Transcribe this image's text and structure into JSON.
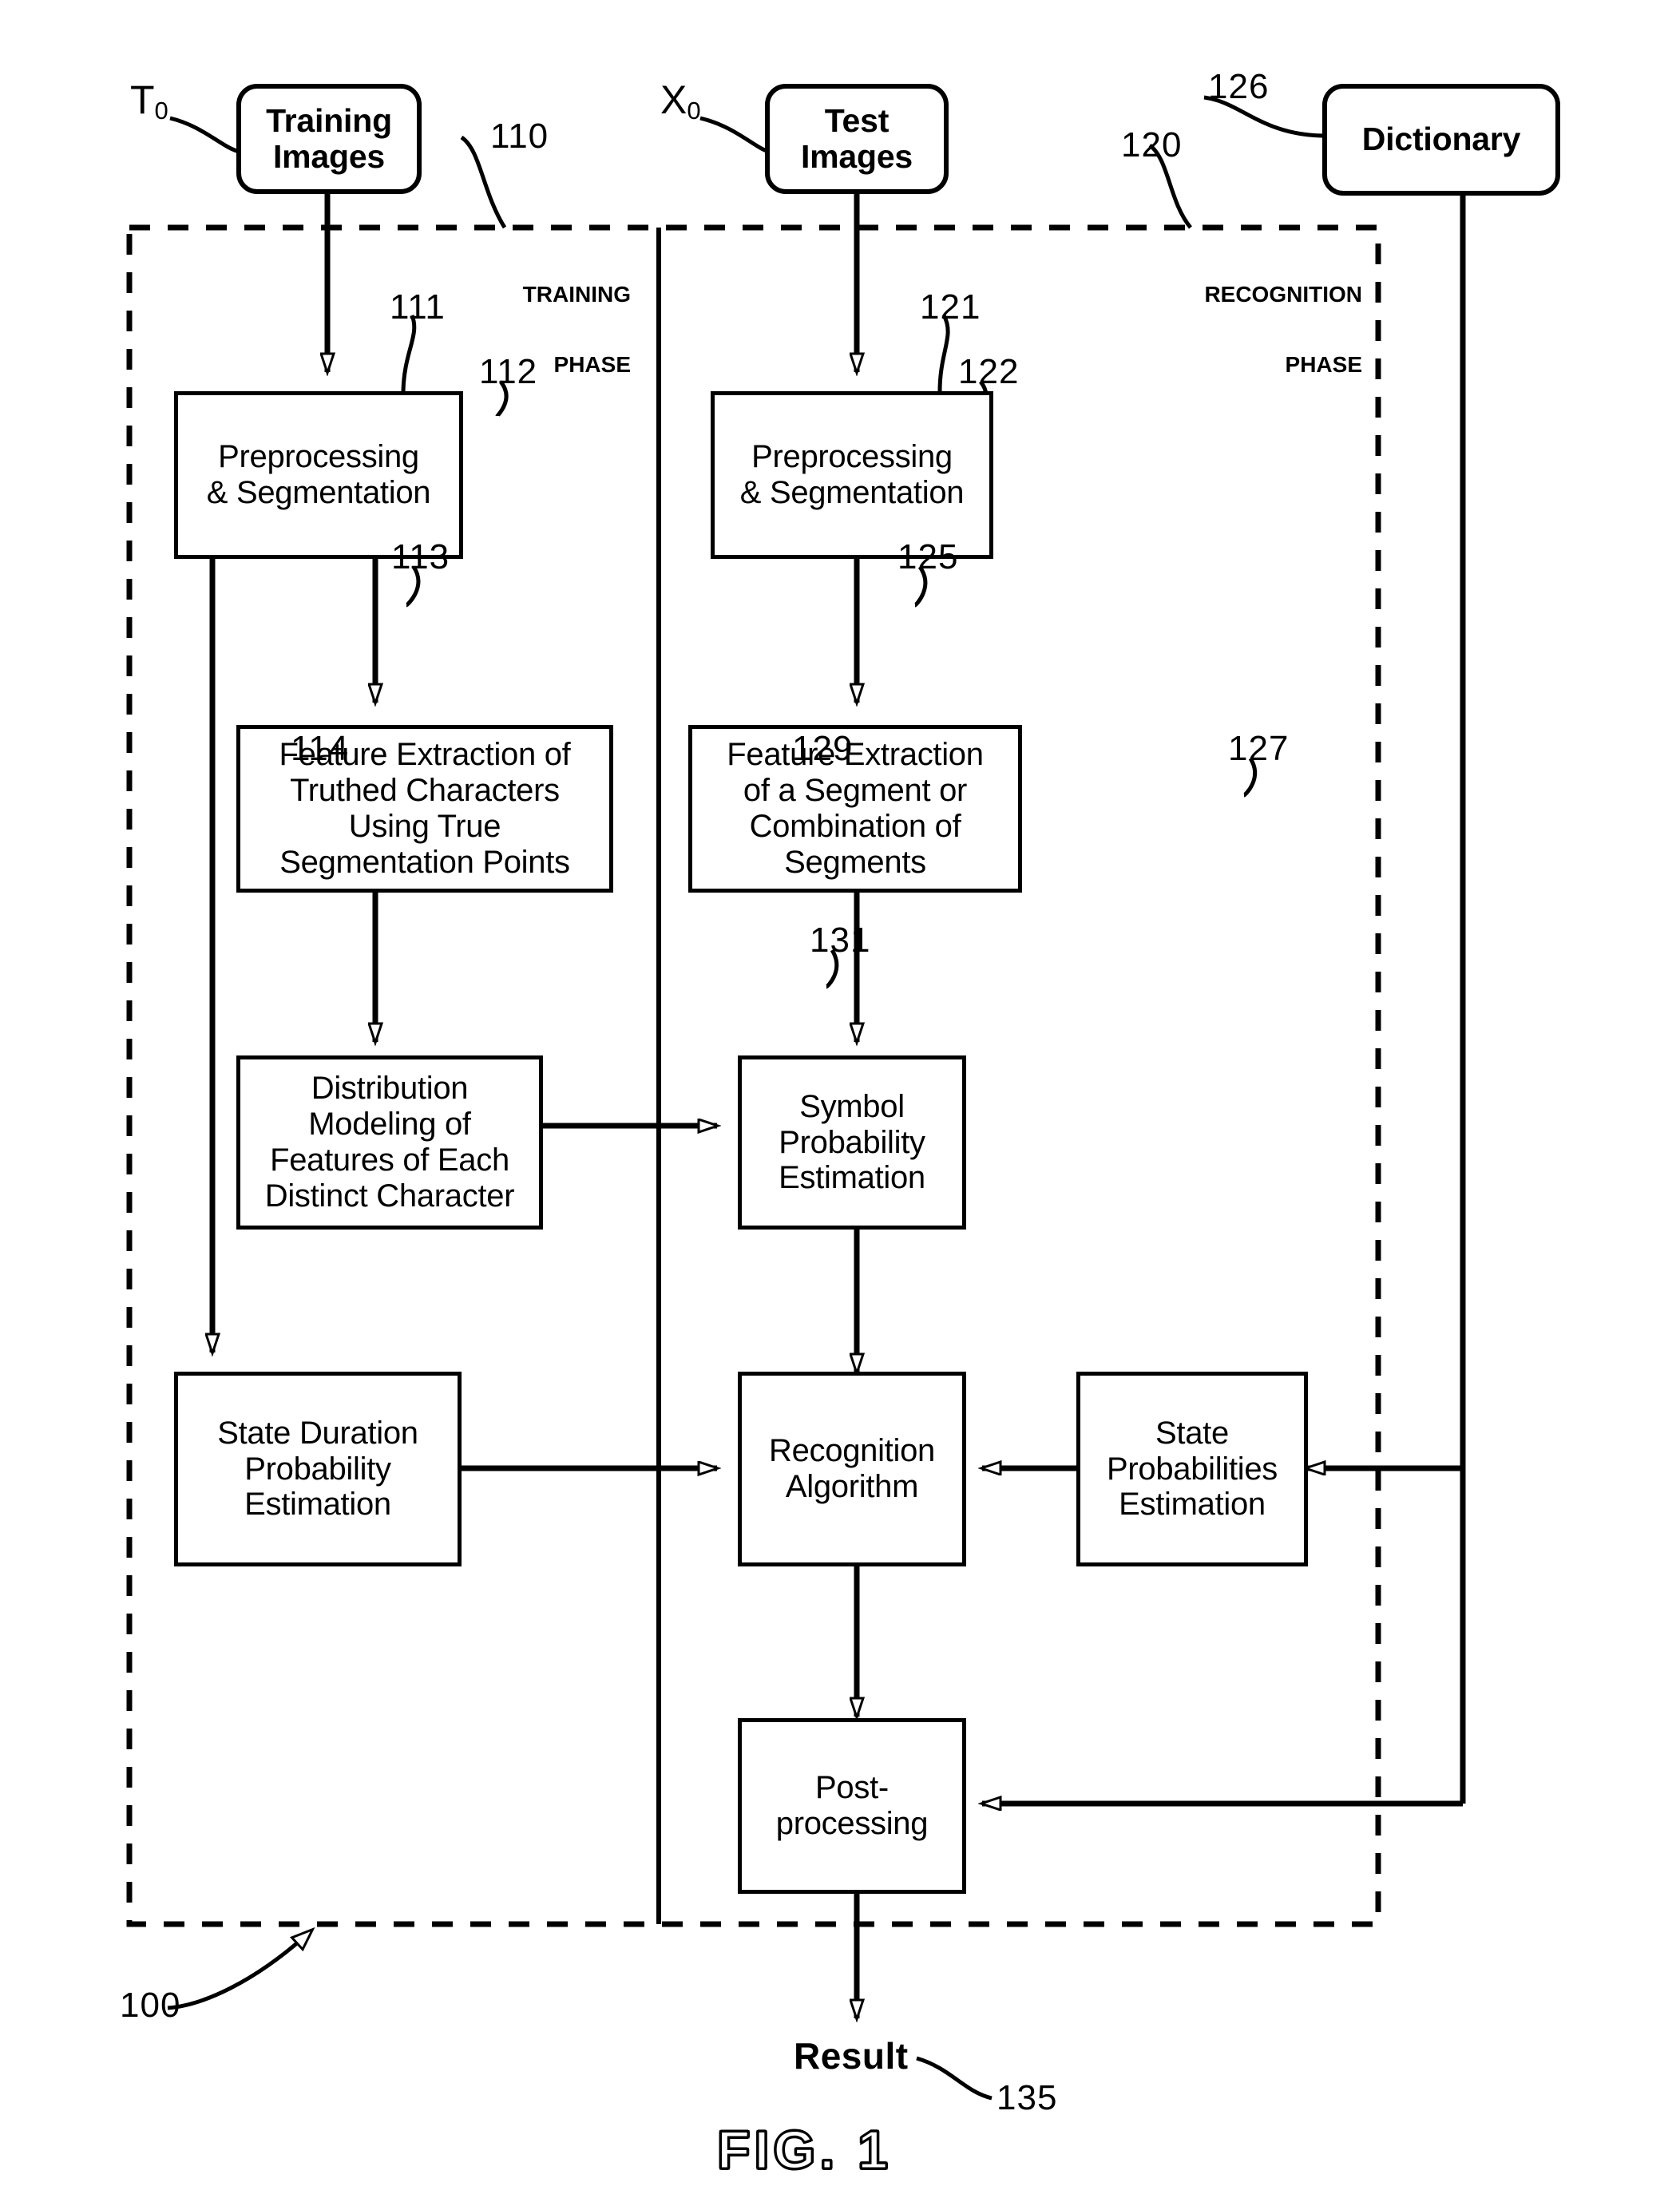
{
  "figure": {
    "caption": "FIG. 1",
    "system_ref": "100"
  },
  "inputs": {
    "training_images": {
      "label": "Training\nImages",
      "symbol": "T",
      "symbol_sub": "0"
    },
    "test_images": {
      "label": "Test\nImages",
      "symbol": "X",
      "symbol_sub": "0"
    },
    "dictionary": {
      "label": "Dictionary",
      "ref": "126"
    }
  },
  "phases": {
    "training": {
      "line1": "TRAINING",
      "line2": "PHASE",
      "ref": "110"
    },
    "recognition": {
      "line1": "RECOGNITION",
      "line2": "PHASE",
      "ref": "120"
    }
  },
  "blocks": {
    "b111": {
      "label": "Preprocessing\n& Segmentation",
      "ref": "111"
    },
    "b112": {
      "label": "Feature Extraction of\nTruthed Characters\nUsing True\nSegmentation Points",
      "ref": "112"
    },
    "b113": {
      "label": "Distribution\nModeling of\nFeatures of Each\nDistinct Character",
      "ref": "113"
    },
    "b114": {
      "label": "State Duration\nProbability\nEstimation",
      "ref": "114"
    },
    "b121": {
      "label": "Preprocessing\n& Segmentation",
      "ref": "121"
    },
    "b122": {
      "label": "Feature Extraction\nof a Segment or\nCombination of\nSegments",
      "ref": "122"
    },
    "b125": {
      "label": "Symbol\nProbability\nEstimation",
      "ref": "125"
    },
    "b127": {
      "label": "State\nProbabilities\nEstimation",
      "ref": "127"
    },
    "b129": {
      "label": "Recognition\nAlgorithm",
      "ref": "129"
    },
    "b131": {
      "label": "Post-\nprocessing",
      "ref": "131"
    }
  },
  "output": {
    "label": "Result",
    "ref": "135"
  },
  "colors": {
    "stroke": "#000000",
    "background": "#ffffff"
  }
}
